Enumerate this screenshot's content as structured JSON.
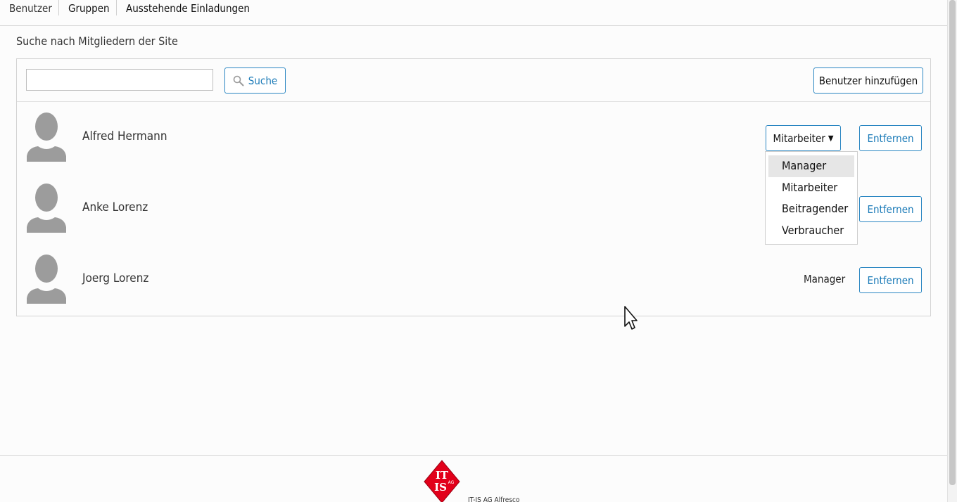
{
  "tabs": [
    {
      "label": "Benutzer"
    },
    {
      "label": "Gruppen"
    },
    {
      "label": "Ausstehende Einladungen"
    }
  ],
  "section_title": "Suche nach Mitgliedern der Site",
  "search": {
    "value": "",
    "button_label": "Suche",
    "button_icon": "search-icon"
  },
  "add_user_label": "Benutzer hinzufügen",
  "members": [
    {
      "name": "Alfred Hermann",
      "role": "Mitarbeiter",
      "role_editable": true,
      "remove_label": "Entfernen"
    },
    {
      "name": "Anke Lorenz",
      "role": "",
      "role_editable": false,
      "remove_label": "Entfernen"
    },
    {
      "name": "Joerg Lorenz",
      "role": "Manager",
      "role_editable": false,
      "remove_label": "Entfernen"
    }
  ],
  "role_dropdown": {
    "open": true,
    "options": [
      "Manager",
      "Mitarbeiter",
      "Beitragender",
      "Verbraucher"
    ],
    "hovered": "Manager"
  },
  "footer": {
    "logo_letters": "IT IS AG",
    "text": "IT-IS AG Alfresco"
  },
  "colors": {
    "accent": "#2a86c2",
    "link": "#1c7bb8",
    "avatar": "#9c9c9c",
    "logo_red": "#e2001a"
  }
}
